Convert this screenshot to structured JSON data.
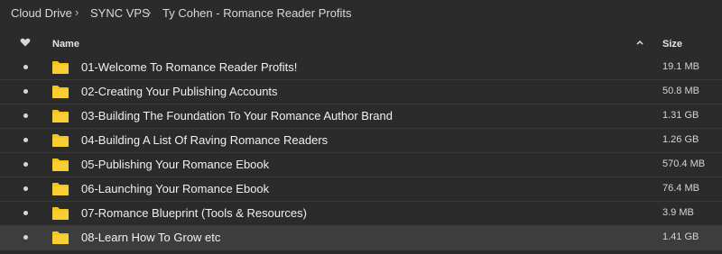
{
  "breadcrumb": [
    "Cloud Drive",
    "SYNC VPS",
    "Ty Cohen - Romance Reader Profits"
  ],
  "header": {
    "name_label": "Name",
    "size_label": "Size"
  },
  "rows": [
    {
      "name": "01-Welcome To Romance Reader Profits!",
      "size": "19.1 MB"
    },
    {
      "name": "02-Creating Your Publishing Accounts",
      "size": "50.8 MB"
    },
    {
      "name": "03-Building The Foundation To Your Romance Author Brand",
      "size": "1.31 GB"
    },
    {
      "name": "04-Building A List Of Raving Romance Readers",
      "size": "1.26 GB"
    },
    {
      "name": "05-Publishing Your Romance Ebook",
      "size": "570.4 MB"
    },
    {
      "name": "06-Launching Your Romance Ebook",
      "size": "76.4 MB"
    },
    {
      "name": "07-Romance Blueprint (Tools & Resources)",
      "size": "3.9 MB"
    },
    {
      "name": "08-Learn How To Grow etc",
      "size": "1.41 GB"
    }
  ],
  "selected_row": 7,
  "colors": {
    "background": "#2b2b2b",
    "folder": "#f5c518",
    "selected": "#3d3d3d"
  }
}
